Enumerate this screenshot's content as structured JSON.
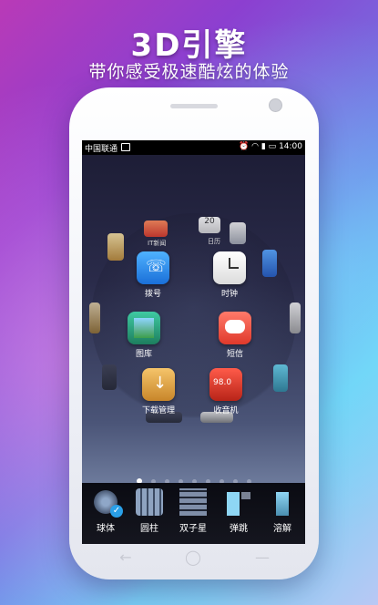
{
  "headline": "3D引擎",
  "subhead": "带你感受极速酷炫的体验",
  "status": {
    "carrier": "中国联通",
    "time": "14:00"
  },
  "apps": [
    {
      "label": "拨号",
      "icon": "phone-icon"
    },
    {
      "label": "时钟",
      "icon": "clock-icon"
    },
    {
      "label": "图库",
      "icon": "gallery-icon"
    },
    {
      "label": "短信",
      "icon": "sms-icon"
    },
    {
      "label": "下载管理",
      "icon": "download-icon"
    },
    {
      "label": "收音机",
      "icon": "radio-icon"
    }
  ],
  "edge_labels": {
    "top_left": "IT新闻",
    "top_mid": "日历",
    "calendar_day": "20",
    "radio_freq": "98.0"
  },
  "dock": [
    {
      "label": "球体",
      "icon": "sphere-effect-icon",
      "selected": true
    },
    {
      "label": "圆柱",
      "icon": "cylinder-effect-icon",
      "selected": false
    },
    {
      "label": "双子星",
      "icon": "gemini-effect-icon",
      "selected": false
    },
    {
      "label": "弹跳",
      "icon": "bounce-effect-icon",
      "selected": false
    },
    {
      "label": "溶解",
      "icon": "dissolve-effect-icon",
      "selected": false
    }
  ],
  "nav": {
    "back": "←",
    "home": "◯",
    "menu": "—"
  },
  "colors": {
    "accent": "#2aa0e8",
    "dock_bg": "#0a0b12"
  }
}
